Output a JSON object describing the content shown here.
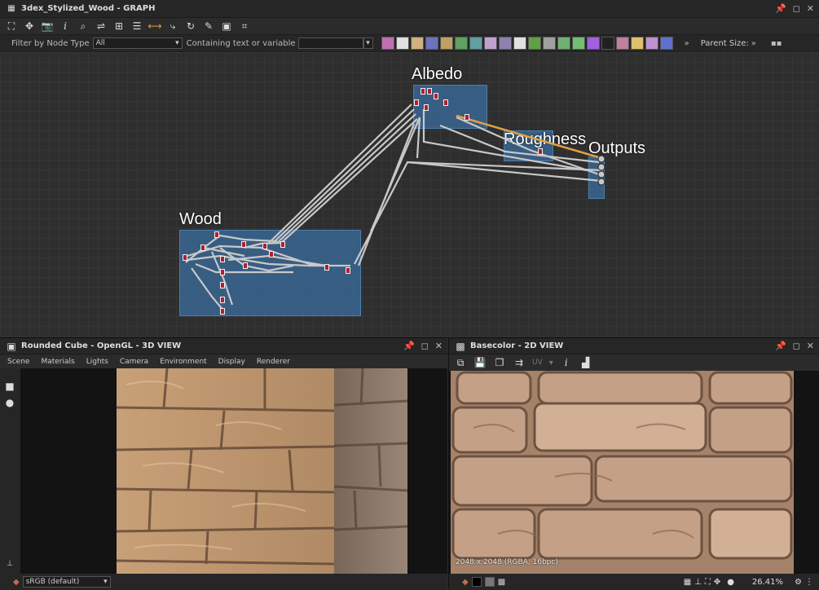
{
  "graph": {
    "title": "3dex_Stylized_Wood - GRAPH",
    "filter_label": "Filter by Node Type",
    "filter_value": "All",
    "containing_label": "Containing text or variable",
    "parent_size_label": "Parent Size:",
    "frames": {
      "albedo": "Albedo",
      "roughness": "Roughness",
      "outputs": "Outputs",
      "wood": "Wood"
    },
    "palette_colors": [
      "#c070b0",
      "#e0e0e0",
      "#d0b080",
      "#7070c0",
      "#c0a060",
      "#60a060",
      "#60a0a0",
      "#c0a0d0",
      "#9080b0",
      "#e0e0e0",
      "#60a040",
      "#a0a0a0",
      "#70b070",
      "#70c070",
      "#a060e0",
      "#202020",
      "#c080a0",
      "#e0c070",
      "#c090d0",
      "#6070d0"
    ]
  },
  "view3d": {
    "title": "Rounded Cube - OpenGL - 3D VIEW",
    "menu": [
      "Scene",
      "Materials",
      "Lights",
      "Camera",
      "Environment",
      "Display",
      "Renderer"
    ],
    "colorspace": "sRGB (default)"
  },
  "view2d": {
    "title": "Basecolor - 2D VIEW",
    "uv_label": "UV",
    "info": "2048 x 2048 (RGBA, 16bpc)",
    "zoom": "26.41%"
  },
  "colors": {
    "wire": "#c8c8c8",
    "accent_wire": "#e0a040",
    "frame": "#3c6ea0"
  }
}
